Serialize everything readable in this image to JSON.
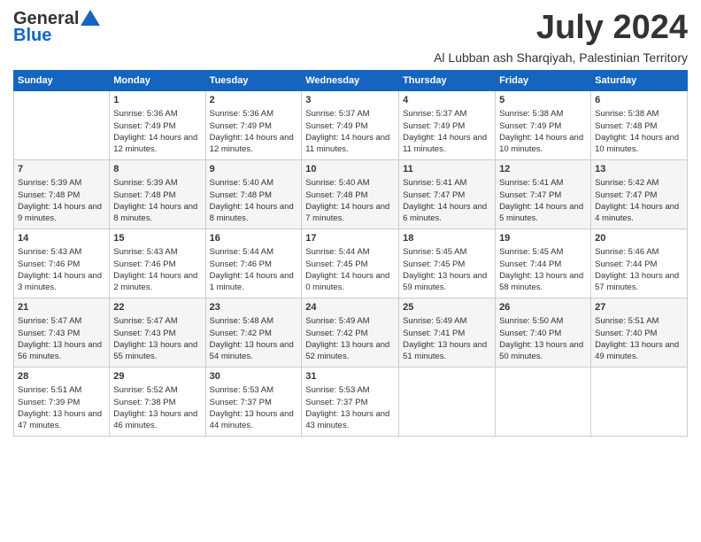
{
  "header": {
    "logo_line1": "General",
    "logo_line2": "Blue",
    "month_title": "July 2024",
    "location": "Al Lubban ash Sharqiyah, Palestinian Territory"
  },
  "days_of_week": [
    "Sunday",
    "Monday",
    "Tuesday",
    "Wednesday",
    "Thursday",
    "Friday",
    "Saturday"
  ],
  "weeks": [
    [
      {
        "num": "",
        "sunrise": "",
        "sunset": "",
        "daylight": ""
      },
      {
        "num": "1",
        "sunrise": "Sunrise: 5:36 AM",
        "sunset": "Sunset: 7:49 PM",
        "daylight": "Daylight: 14 hours and 12 minutes."
      },
      {
        "num": "2",
        "sunrise": "Sunrise: 5:36 AM",
        "sunset": "Sunset: 7:49 PM",
        "daylight": "Daylight: 14 hours and 12 minutes."
      },
      {
        "num": "3",
        "sunrise": "Sunrise: 5:37 AM",
        "sunset": "Sunset: 7:49 PM",
        "daylight": "Daylight: 14 hours and 11 minutes."
      },
      {
        "num": "4",
        "sunrise": "Sunrise: 5:37 AM",
        "sunset": "Sunset: 7:49 PM",
        "daylight": "Daylight: 14 hours and 11 minutes."
      },
      {
        "num": "5",
        "sunrise": "Sunrise: 5:38 AM",
        "sunset": "Sunset: 7:49 PM",
        "daylight": "Daylight: 14 hours and 10 minutes."
      },
      {
        "num": "6",
        "sunrise": "Sunrise: 5:38 AM",
        "sunset": "Sunset: 7:48 PM",
        "daylight": "Daylight: 14 hours and 10 minutes."
      }
    ],
    [
      {
        "num": "7",
        "sunrise": "Sunrise: 5:39 AM",
        "sunset": "Sunset: 7:48 PM",
        "daylight": "Daylight: 14 hours and 9 minutes."
      },
      {
        "num": "8",
        "sunrise": "Sunrise: 5:39 AM",
        "sunset": "Sunset: 7:48 PM",
        "daylight": "Daylight: 14 hours and 8 minutes."
      },
      {
        "num": "9",
        "sunrise": "Sunrise: 5:40 AM",
        "sunset": "Sunset: 7:48 PM",
        "daylight": "Daylight: 14 hours and 8 minutes."
      },
      {
        "num": "10",
        "sunrise": "Sunrise: 5:40 AM",
        "sunset": "Sunset: 7:48 PM",
        "daylight": "Daylight: 14 hours and 7 minutes."
      },
      {
        "num": "11",
        "sunrise": "Sunrise: 5:41 AM",
        "sunset": "Sunset: 7:47 PM",
        "daylight": "Daylight: 14 hours and 6 minutes."
      },
      {
        "num": "12",
        "sunrise": "Sunrise: 5:41 AM",
        "sunset": "Sunset: 7:47 PM",
        "daylight": "Daylight: 14 hours and 5 minutes."
      },
      {
        "num": "13",
        "sunrise": "Sunrise: 5:42 AM",
        "sunset": "Sunset: 7:47 PM",
        "daylight": "Daylight: 14 hours and 4 minutes."
      }
    ],
    [
      {
        "num": "14",
        "sunrise": "Sunrise: 5:43 AM",
        "sunset": "Sunset: 7:46 PM",
        "daylight": "Daylight: 14 hours and 3 minutes."
      },
      {
        "num": "15",
        "sunrise": "Sunrise: 5:43 AM",
        "sunset": "Sunset: 7:46 PM",
        "daylight": "Daylight: 14 hours and 2 minutes."
      },
      {
        "num": "16",
        "sunrise": "Sunrise: 5:44 AM",
        "sunset": "Sunset: 7:46 PM",
        "daylight": "Daylight: 14 hours and 1 minute."
      },
      {
        "num": "17",
        "sunrise": "Sunrise: 5:44 AM",
        "sunset": "Sunset: 7:45 PM",
        "daylight": "Daylight: 14 hours and 0 minutes."
      },
      {
        "num": "18",
        "sunrise": "Sunrise: 5:45 AM",
        "sunset": "Sunset: 7:45 PM",
        "daylight": "Daylight: 13 hours and 59 minutes."
      },
      {
        "num": "19",
        "sunrise": "Sunrise: 5:45 AM",
        "sunset": "Sunset: 7:44 PM",
        "daylight": "Daylight: 13 hours and 58 minutes."
      },
      {
        "num": "20",
        "sunrise": "Sunrise: 5:46 AM",
        "sunset": "Sunset: 7:44 PM",
        "daylight": "Daylight: 13 hours and 57 minutes."
      }
    ],
    [
      {
        "num": "21",
        "sunrise": "Sunrise: 5:47 AM",
        "sunset": "Sunset: 7:43 PM",
        "daylight": "Daylight: 13 hours and 56 minutes."
      },
      {
        "num": "22",
        "sunrise": "Sunrise: 5:47 AM",
        "sunset": "Sunset: 7:43 PM",
        "daylight": "Daylight: 13 hours and 55 minutes."
      },
      {
        "num": "23",
        "sunrise": "Sunrise: 5:48 AM",
        "sunset": "Sunset: 7:42 PM",
        "daylight": "Daylight: 13 hours and 54 minutes."
      },
      {
        "num": "24",
        "sunrise": "Sunrise: 5:49 AM",
        "sunset": "Sunset: 7:42 PM",
        "daylight": "Daylight: 13 hours and 52 minutes."
      },
      {
        "num": "25",
        "sunrise": "Sunrise: 5:49 AM",
        "sunset": "Sunset: 7:41 PM",
        "daylight": "Daylight: 13 hours and 51 minutes."
      },
      {
        "num": "26",
        "sunrise": "Sunrise: 5:50 AM",
        "sunset": "Sunset: 7:40 PM",
        "daylight": "Daylight: 13 hours and 50 minutes."
      },
      {
        "num": "27",
        "sunrise": "Sunrise: 5:51 AM",
        "sunset": "Sunset: 7:40 PM",
        "daylight": "Daylight: 13 hours and 49 minutes."
      }
    ],
    [
      {
        "num": "28",
        "sunrise": "Sunrise: 5:51 AM",
        "sunset": "Sunset: 7:39 PM",
        "daylight": "Daylight: 13 hours and 47 minutes."
      },
      {
        "num": "29",
        "sunrise": "Sunrise: 5:52 AM",
        "sunset": "Sunset: 7:38 PM",
        "daylight": "Daylight: 13 hours and 46 minutes."
      },
      {
        "num": "30",
        "sunrise": "Sunrise: 5:53 AM",
        "sunset": "Sunset: 7:37 PM",
        "daylight": "Daylight: 13 hours and 44 minutes."
      },
      {
        "num": "31",
        "sunrise": "Sunrise: 5:53 AM",
        "sunset": "Sunset: 7:37 PM",
        "daylight": "Daylight: 13 hours and 43 minutes."
      },
      {
        "num": "",
        "sunrise": "",
        "sunset": "",
        "daylight": ""
      },
      {
        "num": "",
        "sunrise": "",
        "sunset": "",
        "daylight": ""
      },
      {
        "num": "",
        "sunrise": "",
        "sunset": "",
        "daylight": ""
      }
    ]
  ]
}
